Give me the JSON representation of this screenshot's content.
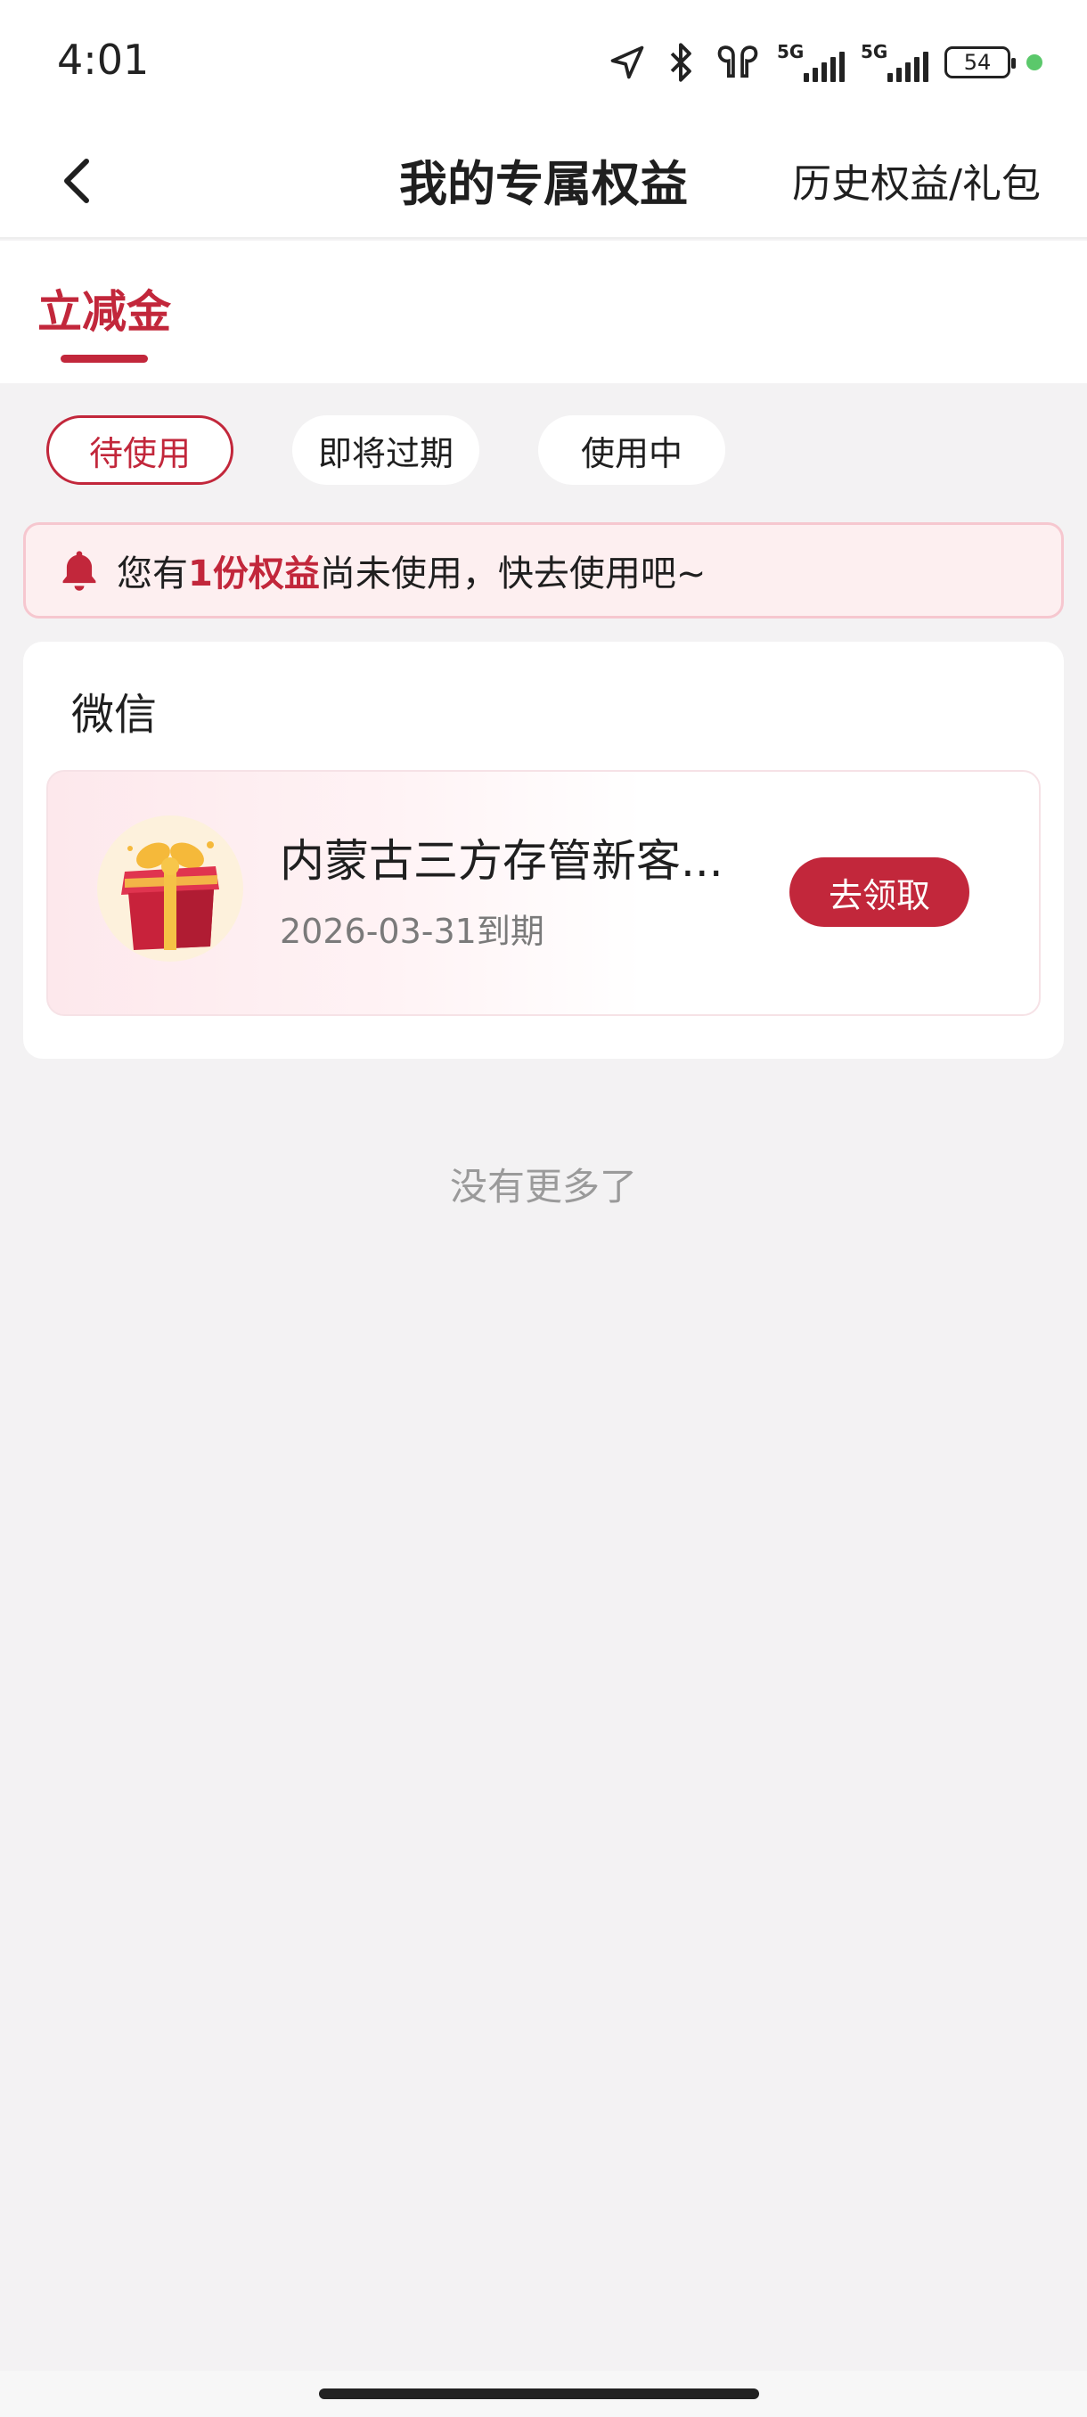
{
  "status_bar": {
    "time": "4:01",
    "signal1_tag": "5G",
    "signal2_tag": "5G",
    "battery": "54",
    "icons": [
      "location-arrow-icon",
      "bluetooth-icon",
      "earbuds-icon",
      "signal-icon",
      "signal-icon",
      "battery-icon"
    ]
  },
  "nav": {
    "title": "我的专属权益",
    "right_link": "历史权益/礼包",
    "back_icon": "chevron-left-icon"
  },
  "tabs": {
    "main": "立减金"
  },
  "filters": [
    {
      "label": "待使用",
      "active": true
    },
    {
      "label": "即将过期",
      "active": false
    },
    {
      "label": "使用中",
      "active": false
    }
  ],
  "notice": {
    "prefix": "您有",
    "highlight": "1份权益",
    "suffix": "尚未使用，快去使用吧~"
  },
  "card": {
    "title": "微信",
    "item": {
      "name": "内蒙古三方存管新客...",
      "date": "2026-03-31到期",
      "button": "去领取"
    }
  },
  "footer_text": "没有更多了",
  "colors": {
    "accent": "#c2273b",
    "background": "#f3f2f3",
    "notice_bg": "#fdeff0"
  }
}
